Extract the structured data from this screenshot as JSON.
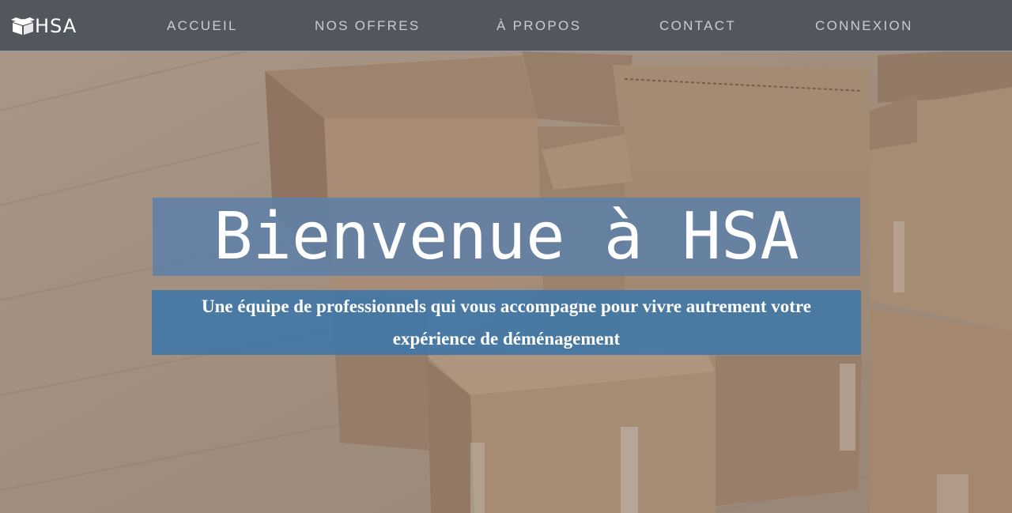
{
  "navbar": {
    "logo_text": "HSA",
    "items": [
      {
        "label": "ACCUEIL"
      },
      {
        "label": "NOS OFFRES"
      },
      {
        "label": "À PROPOS"
      },
      {
        "label": "CONTACT"
      },
      {
        "label": "CONNEXION"
      }
    ]
  },
  "hero": {
    "title": "Bienvenue à HSA",
    "subtitle": "Une équipe de professionnels qui vous accompagne pour vivre autrement votre expérience de déménagement"
  },
  "colors": {
    "navbar_bg": "#52575d",
    "title_bg": "#5f80a6",
    "subtitle_bg": "#3e76a8",
    "nav_text": "#c9ccd0"
  },
  "icons": {
    "logo": "box-icon"
  }
}
